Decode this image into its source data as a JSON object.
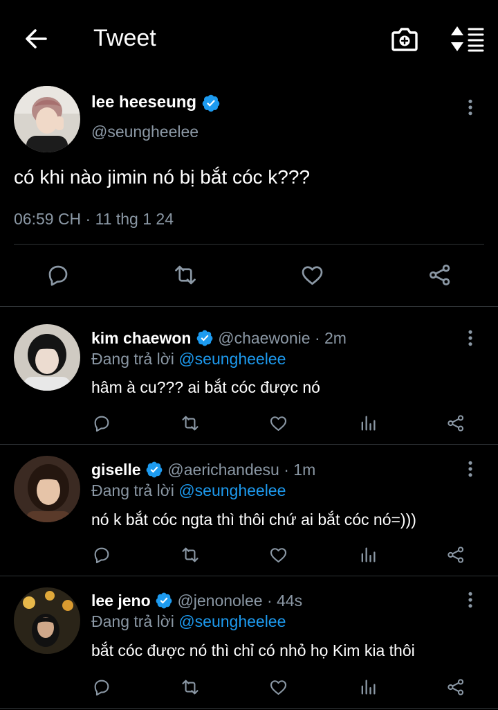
{
  "header": {
    "title": "Tweet"
  },
  "main_tweet": {
    "display_name": "lee heeseung",
    "handle": "@seungheelee",
    "text": "có khi nào jimin nó bị bắt cóc k???",
    "timestamp": "06:59 CH · 11 thg 1 24"
  },
  "replies": [
    {
      "display_name": "kim chaewon",
      "handle": "@chaewonie",
      "time": "· 2m",
      "replying_prefix": "Đang trả lời",
      "replying_to": "@seungheelee",
      "text": "hâm à cu??? ai bắt cóc được nó"
    },
    {
      "display_name": "giselle",
      "handle": "@aerichandesu",
      "time": "· 1m",
      "replying_prefix": "Đang trả lời",
      "replying_to": "@seungheelee",
      "text": "nó k bắt cóc ngta thì thôi chứ ai bắt cóc nó=)))"
    },
    {
      "display_name": "lee jeno",
      "handle": "@jenonolee",
      "time": "· 44s",
      "replying_prefix": "Đang trả lời",
      "replying_to": "@seungheelee",
      "text": "bắt cóc được nó thì chỉ có nhỏ họ Kim kia thôi"
    }
  ],
  "colors": {
    "background": "#000000",
    "accent": "#1d9bf0",
    "secondary_text": "#8b98a5",
    "divider": "#2f3336"
  }
}
